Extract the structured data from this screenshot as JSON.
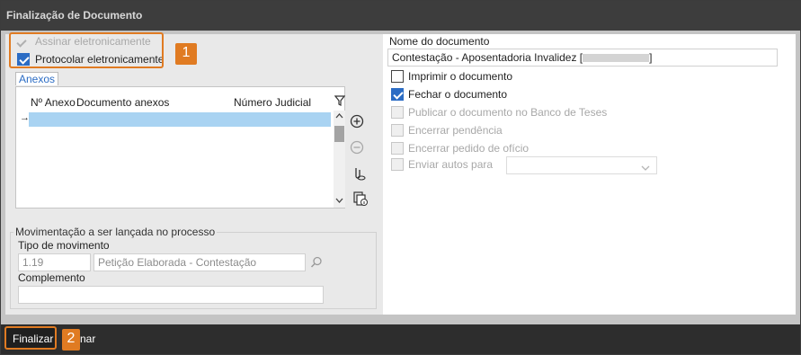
{
  "window": {
    "title": "Finalização de Documento"
  },
  "options": {
    "assinar_label": "Assinar eletronicamente",
    "protocolar_label": "Protocolar eletronicamente"
  },
  "anexos": {
    "tab_label": "Anexos",
    "columns": [
      "Nº Anexo",
      "Documento anexos",
      "Número Judicial"
    ],
    "current_row_marker": "→"
  },
  "movimentacao": {
    "legend": "Movimentação a ser lançada no processo",
    "tipo_label": "Tipo de movimento",
    "tipo_code": "1.19",
    "tipo_desc": "Petição Elaborada - Contestação",
    "complemento_label": "Complemento",
    "complemento_value": ""
  },
  "documento": {
    "nome_label": "Nome do documento",
    "nome_value": "Contestação - Aposentadoria Invalidez [",
    "nome_suffix": "]",
    "imprimir_label": "Imprimir o documento",
    "fechar_label": "Fechar o documento",
    "publicar_label": "Publicar o documento no Banco de Teses",
    "encerrar_pendencia_label": "Encerrar pendência",
    "encerrar_pedido_label": "Encerrar pedido de ofício",
    "enviar_autos_label": "Enviar autos para",
    "enviar_autos_value": ""
  },
  "footer": {
    "finalizar_label": "Finalizar",
    "cancelar_fragment": "nar"
  },
  "callouts": {
    "one": "1",
    "two": "2"
  },
  "colors": {
    "accent": "#2b6cc4",
    "callout": "#e07b22",
    "titlebar": "#3d3d3d"
  },
  "icons": [
    "check-icon",
    "filter-icon",
    "add-circle-icon",
    "remove-circle-icon",
    "attach-icon",
    "copy-info-icon",
    "search-icon",
    "chevron-down-icon",
    "arrow-right-icon",
    "scroll-up-icon",
    "scroll-down-icon"
  ]
}
